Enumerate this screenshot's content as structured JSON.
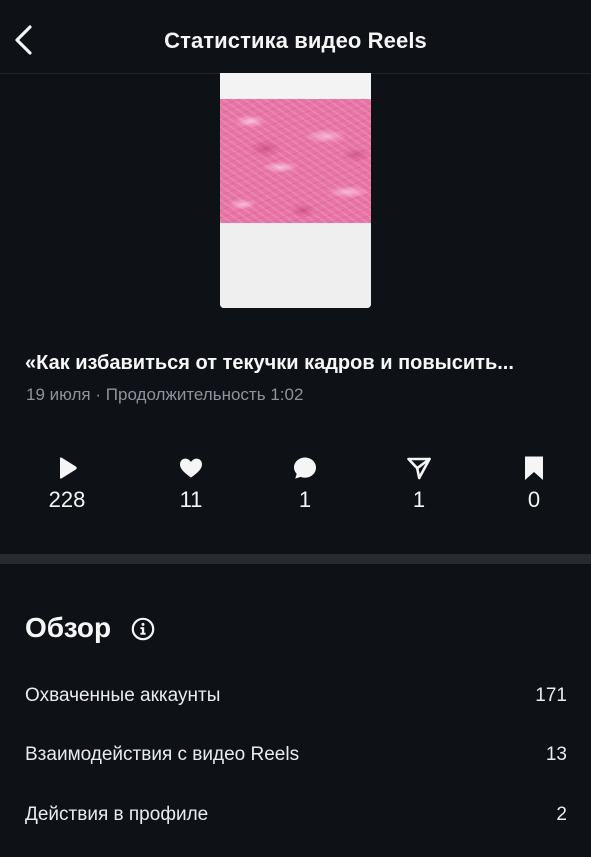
{
  "header": {
    "title": "Статистика видео Reels",
    "back_icon": "chevron-left-icon"
  },
  "reel": {
    "title": "«Как избавиться от текучки кадров и повысить...",
    "date": "19 июля",
    "separator": "·",
    "duration_label": "Продолжительность",
    "duration": "1:02"
  },
  "stats": [
    {
      "icon": "play-icon",
      "value": "228"
    },
    {
      "icon": "heart-icon",
      "value": "11"
    },
    {
      "icon": "comment-icon",
      "value": "1"
    },
    {
      "icon": "share-icon",
      "value": "1"
    },
    {
      "icon": "bookmark-icon",
      "value": "0"
    }
  ],
  "overview": {
    "title": "Обзор",
    "info_icon": "info-icon",
    "rows": [
      {
        "label": "Охваченные аккаунты",
        "value": "171"
      },
      {
        "label": "Взаимодействия с видео Reels",
        "value": "13"
      },
      {
        "label": "Действия в профиле",
        "value": "2"
      }
    ]
  },
  "colors": {
    "background": "#0e1116",
    "divider": "#262b31",
    "text": "#f5f5f5",
    "muted": "#8e949c",
    "thumbnail_pink": "#e874a6"
  }
}
